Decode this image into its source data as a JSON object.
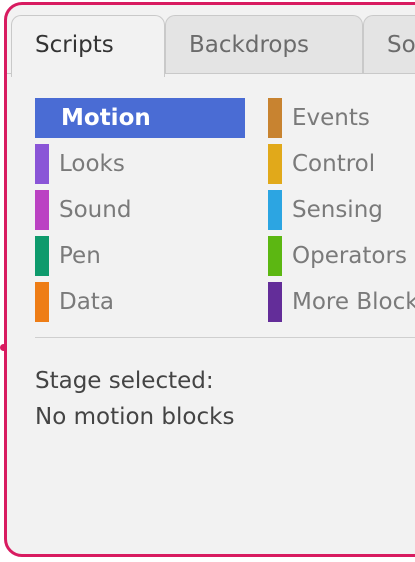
{
  "tabs": [
    {
      "label": "Scripts",
      "active": true
    },
    {
      "label": "Backdrops",
      "active": false
    },
    {
      "label": "Sounds",
      "active": false
    }
  ],
  "categories": {
    "left": [
      {
        "label": "Motion",
        "color": "#4a6cd4",
        "selected": true
      },
      {
        "label": "Looks",
        "color": "#8a55d7"
      },
      {
        "label": "Sound",
        "color": "#bb42c3"
      },
      {
        "label": "Pen",
        "color": "#0e9a6c"
      },
      {
        "label": "Data",
        "color": "#ee7d16"
      }
    ],
    "right": [
      {
        "label": "Events",
        "color": "#c88330"
      },
      {
        "label": "Control",
        "color": "#e1a91a"
      },
      {
        "label": "Sensing",
        "color": "#2ca5e2"
      },
      {
        "label": "Operators",
        "color": "#5cb712"
      },
      {
        "label": "More Blocks",
        "color": "#632d99"
      }
    ]
  },
  "message": {
    "line1": "Stage selected:",
    "line2": "No motion blocks"
  },
  "theme": {
    "frame_color": "#d81b60",
    "selected_bg": "#4a6cd4"
  }
}
